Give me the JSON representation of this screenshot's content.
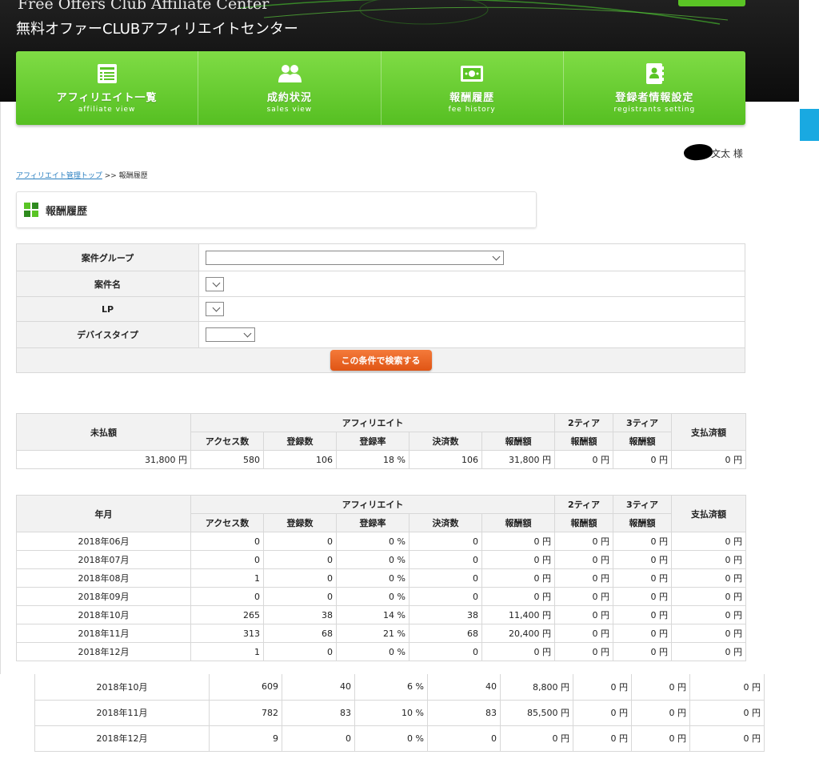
{
  "header": {
    "brand_en": "Free Offers Club Affiliate Center",
    "brand_ja": "無料オファーCLUBアフィリエイトセンター",
    "accent_color": "#5ac425"
  },
  "nav": [
    {
      "label": "アフィリエイト一覧",
      "sub": "affiliate view",
      "icon": "list-icon"
    },
    {
      "label": "成約状況",
      "sub": "sales view",
      "icon": "users-icon"
    },
    {
      "label": "報酬履歴",
      "sub": "fee history",
      "icon": "money-icon"
    },
    {
      "label": "登録者情報設定",
      "sub": "registrants setting",
      "icon": "address-book-icon"
    }
  ],
  "user": {
    "name": "文太 様"
  },
  "breadcrumb": {
    "link": "アフィリエイト管理トップ",
    "separator": ">>",
    "current": "報酬履歴"
  },
  "section_title": "報酬履歴",
  "search": {
    "fields": [
      {
        "label": "案件グループ",
        "value": ""
      },
      {
        "label": "案件名",
        "value": ""
      },
      {
        "label": "LP",
        "value": ""
      },
      {
        "label": "デバイスタイプ",
        "value": ""
      }
    ],
    "button_label": "この条件で検索する",
    "button_color": "#e8601f"
  },
  "summary": {
    "headers": {
      "unpaid": "未払額",
      "affiliate": "アフィリエイト",
      "tier2": "2ティア",
      "tier3": "3ティア",
      "paid": "支払済額",
      "access": "アクセス数",
      "registrations": "登録数",
      "rate": "登録率",
      "settled": "決済数",
      "fee": "報酬額",
      "tier_fee": "報酬額"
    },
    "row": {
      "unpaid": "31,800 円",
      "access": "580",
      "registrations": "106",
      "rate": "18 %",
      "settled": "106",
      "fee": "31,800 円",
      "tier2": "0 円",
      "tier3": "0 円",
      "paid": "0 円"
    }
  },
  "monthly": {
    "headers": {
      "month": "年月",
      "affiliate": "アフィリエイト",
      "tier2": "2ティア",
      "tier3": "3ティア",
      "paid": "支払済額",
      "access": "アクセス数",
      "registrations": "登録数",
      "rate": "登録率",
      "settled": "決済数",
      "fee": "報酬額",
      "tier_fee": "報酬額"
    },
    "rows": [
      {
        "month": "2018年06月",
        "access": "0",
        "registrations": "0",
        "rate": "0 %",
        "settled": "0",
        "fee": "0 円",
        "tier2": "0 円",
        "tier3": "0 円",
        "paid": "0 円"
      },
      {
        "month": "2018年07月",
        "access": "0",
        "registrations": "0",
        "rate": "0 %",
        "settled": "0",
        "fee": "0 円",
        "tier2": "0 円",
        "tier3": "0 円",
        "paid": "0 円"
      },
      {
        "month": "2018年08月",
        "access": "1",
        "registrations": "0",
        "rate": "0 %",
        "settled": "0",
        "fee": "0 円",
        "tier2": "0 円",
        "tier3": "0 円",
        "paid": "0 円"
      },
      {
        "month": "2018年09月",
        "access": "0",
        "registrations": "0",
        "rate": "0 %",
        "settled": "0",
        "fee": "0 円",
        "tier2": "0 円",
        "tier3": "0 円",
        "paid": "0 円"
      },
      {
        "month": "2018年10月",
        "access": "265",
        "registrations": "38",
        "rate": "14 %",
        "settled": "38",
        "fee": "11,400 円",
        "tier2": "0 円",
        "tier3": "0 円",
        "paid": "0 円"
      },
      {
        "month": "2018年11月",
        "access": "313",
        "registrations": "68",
        "rate": "21 %",
        "settled": "68",
        "fee": "20,400 円",
        "tier2": "0 円",
        "tier3": "0 円",
        "paid": "0 円"
      },
      {
        "month": "2018年12月",
        "access": "1",
        "registrations": "0",
        "rate": "0 %",
        "settled": "0",
        "fee": "0 円",
        "tier2": "0 円",
        "tier3": "0 円",
        "paid": "0 円"
      }
    ]
  },
  "overlay": {
    "rows": [
      {
        "month": "2018年10月",
        "access": "609",
        "registrations": "40",
        "rate": "6 %",
        "settled": "40",
        "fee": "8,800 円",
        "tier2": "0 円",
        "tier3": "0 円",
        "paid": "0 円"
      },
      {
        "month": "2018年11月",
        "access": "782",
        "registrations": "83",
        "rate": "10 %",
        "settled": "83",
        "fee": "85,500 円",
        "tier2": "0 円",
        "tier3": "0 円",
        "paid": "0 円"
      },
      {
        "month": "2018年12月",
        "access": "9",
        "registrations": "0",
        "rate": "0 %",
        "settled": "0",
        "fee": "0 円",
        "tier2": "0 円",
        "tier3": "0 円",
        "paid": "0 円"
      }
    ]
  }
}
